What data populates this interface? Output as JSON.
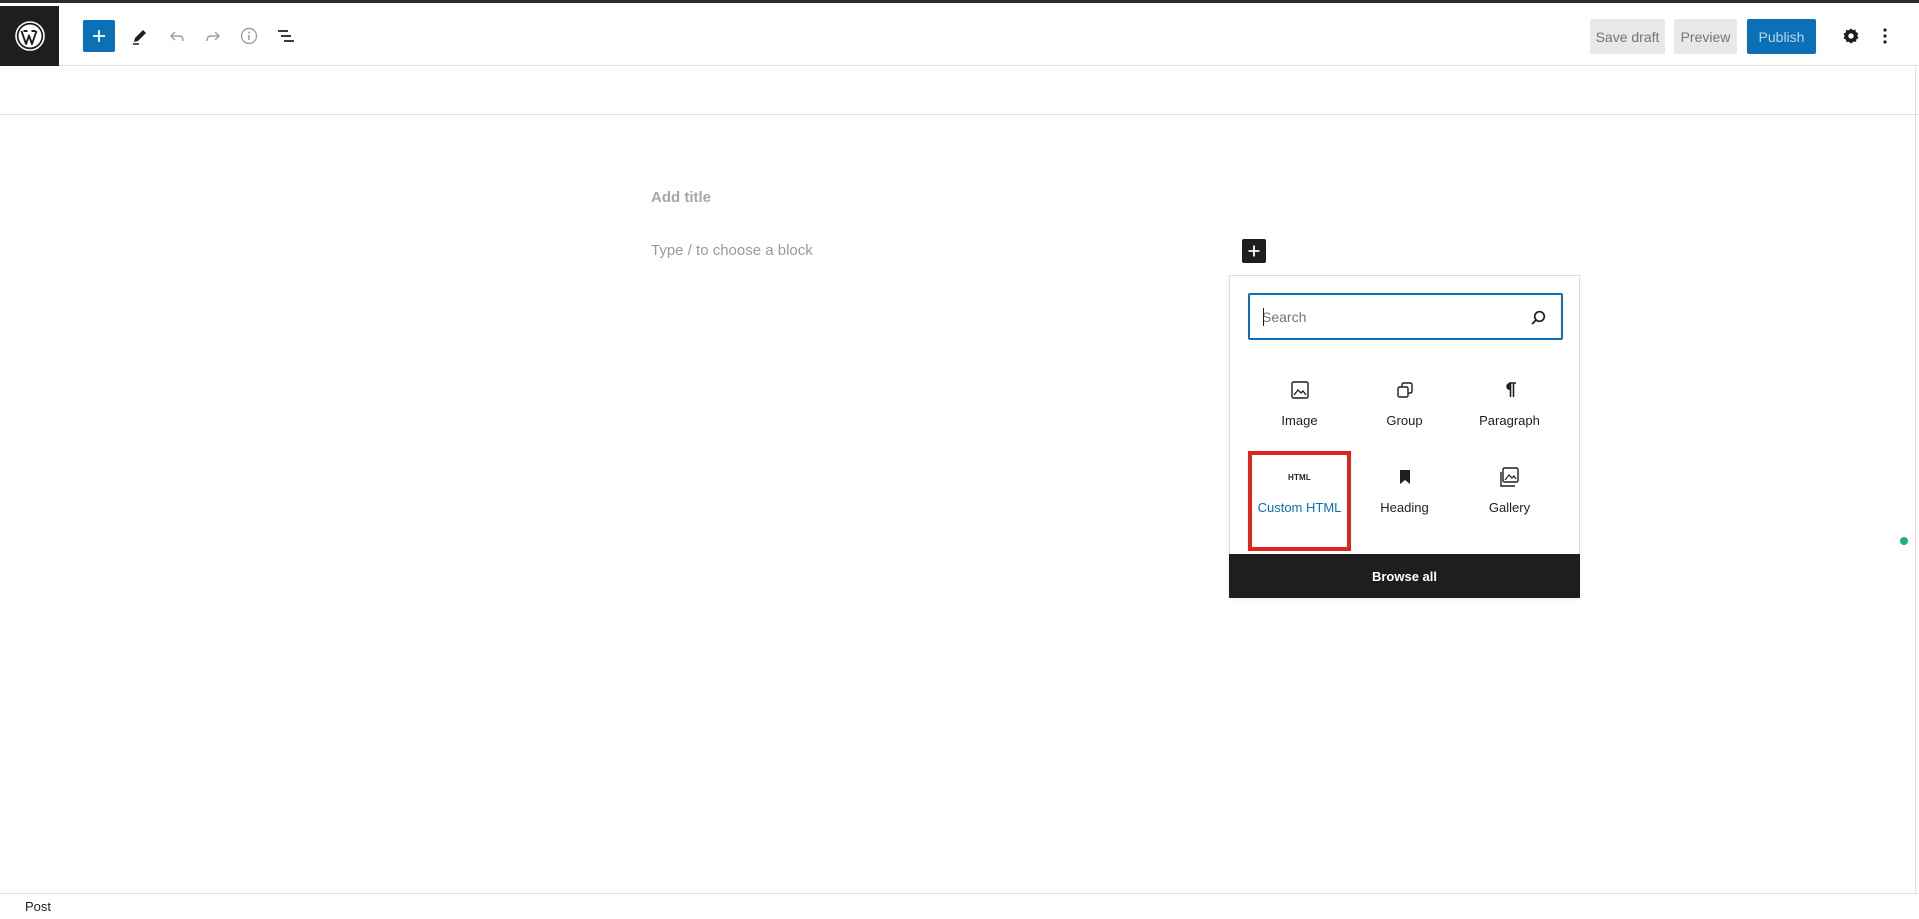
{
  "toolbar": {
    "save_draft_label": "Save draft",
    "preview_label": "Preview",
    "publish_label": "Publish",
    "icons": [
      "wordpress-logo",
      "plus-icon",
      "pencil-icon",
      "undo-icon",
      "redo-icon",
      "info-icon",
      "list-view-icon",
      "gear-icon",
      "more-vertical-icon"
    ]
  },
  "editor": {
    "title_placeholder": "Add title",
    "block_placeholder": "Type / to choose a block"
  },
  "inserter": {
    "search_placeholder": "Search",
    "blocks": [
      {
        "label": "Image",
        "icon": "image-icon"
      },
      {
        "label": "Group",
        "icon": "group-icon"
      },
      {
        "label": "Paragraph",
        "icon": "paragraph-icon"
      },
      {
        "label": "Custom HTML",
        "icon": "html-icon",
        "icon_text": "HTML",
        "highlighted": true
      },
      {
        "label": "Heading",
        "icon": "heading-bookmark-icon"
      },
      {
        "label": "Gallery",
        "icon": "gallery-icon"
      }
    ],
    "browse_all_label": "Browse all"
  },
  "footer": {
    "label": "Post"
  },
  "colors": {
    "accent": "#0b70b5",
    "highlight_border": "#e0251c",
    "dark": "#1e1e1e",
    "status_dot": "#1cb27a"
  }
}
